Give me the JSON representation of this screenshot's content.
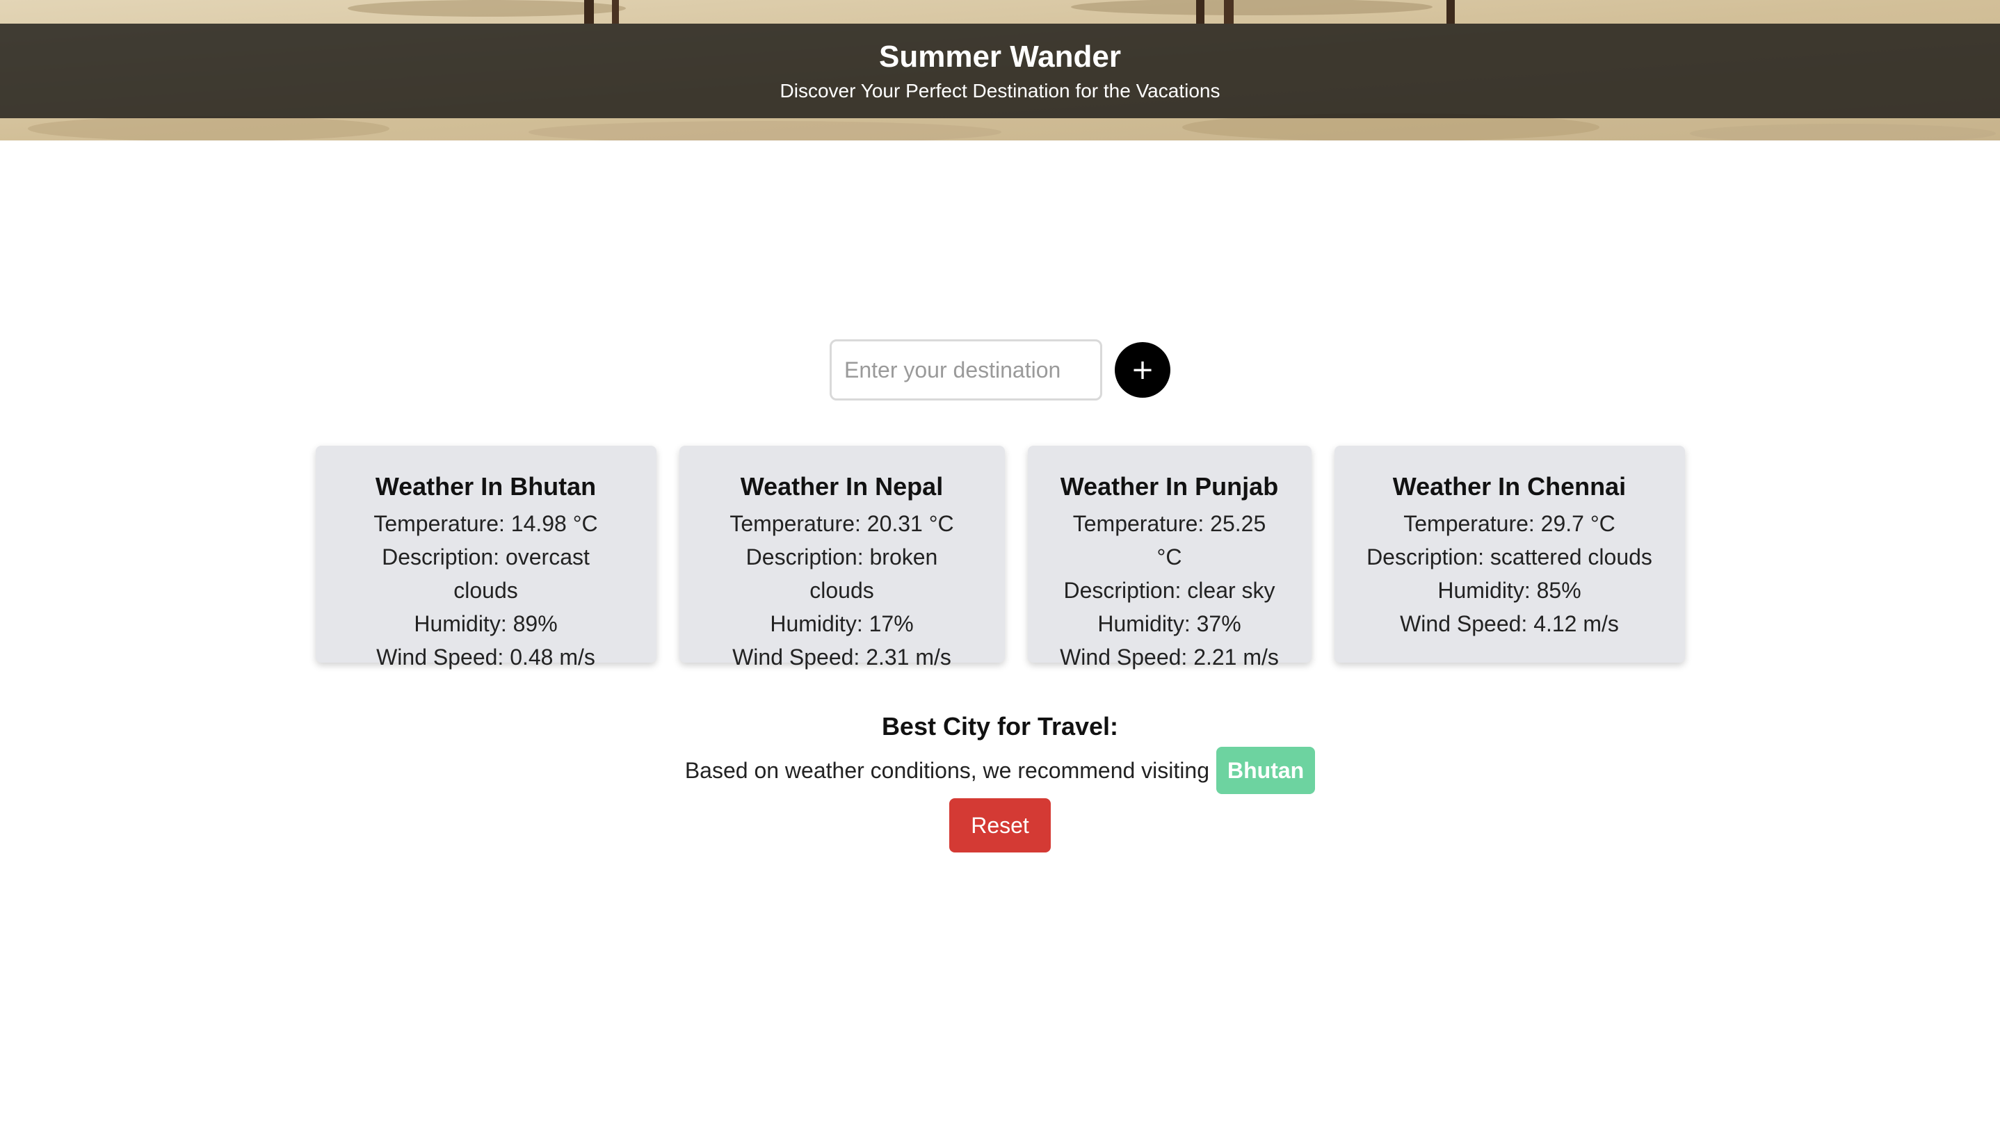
{
  "header": {
    "title": "Summer Wander",
    "subtitle": "Discover Your Perfect Destination for the Vacations"
  },
  "search": {
    "placeholder": "Enter your destination",
    "value": "",
    "add_label": "+"
  },
  "cards": [
    {
      "title": "Weather In Bhutan",
      "temperature": "Temperature: 14.98 °C",
      "description": "Description: overcast clouds",
      "humidity": "Humidity: 89%",
      "wind": "Wind Speed: 0.48 m/s"
    },
    {
      "title": "Weather In Nepal",
      "temperature": "Temperature: 20.31 °C",
      "description": "Description: broken clouds",
      "humidity": "Humidity: 17%",
      "wind": "Wind Speed: 2.31 m/s"
    },
    {
      "title": "Weather In Punjab",
      "temperature": "Temperature: 25.25 °C",
      "description": "Description: clear sky",
      "humidity": "Humidity: 37%",
      "wind": "Wind Speed: 2.21 m/s"
    },
    {
      "title": "Weather In Chennai",
      "temperature": "Temperature: 29.7 °C",
      "description": "Description: scattered clouds",
      "humidity": "Humidity: 85%",
      "wind": "Wind Speed: 4.12 m/s"
    }
  ],
  "recommendation": {
    "title": "Best City for Travel:",
    "text": "Based on weather conditions, we recommend visiting",
    "city": "Bhutan"
  },
  "reset_label": "Reset",
  "colors": {
    "card_background": "#e5e6ea",
    "badge": "#6dd3a0",
    "reset": "#d43a34",
    "add_button": "#000000"
  }
}
